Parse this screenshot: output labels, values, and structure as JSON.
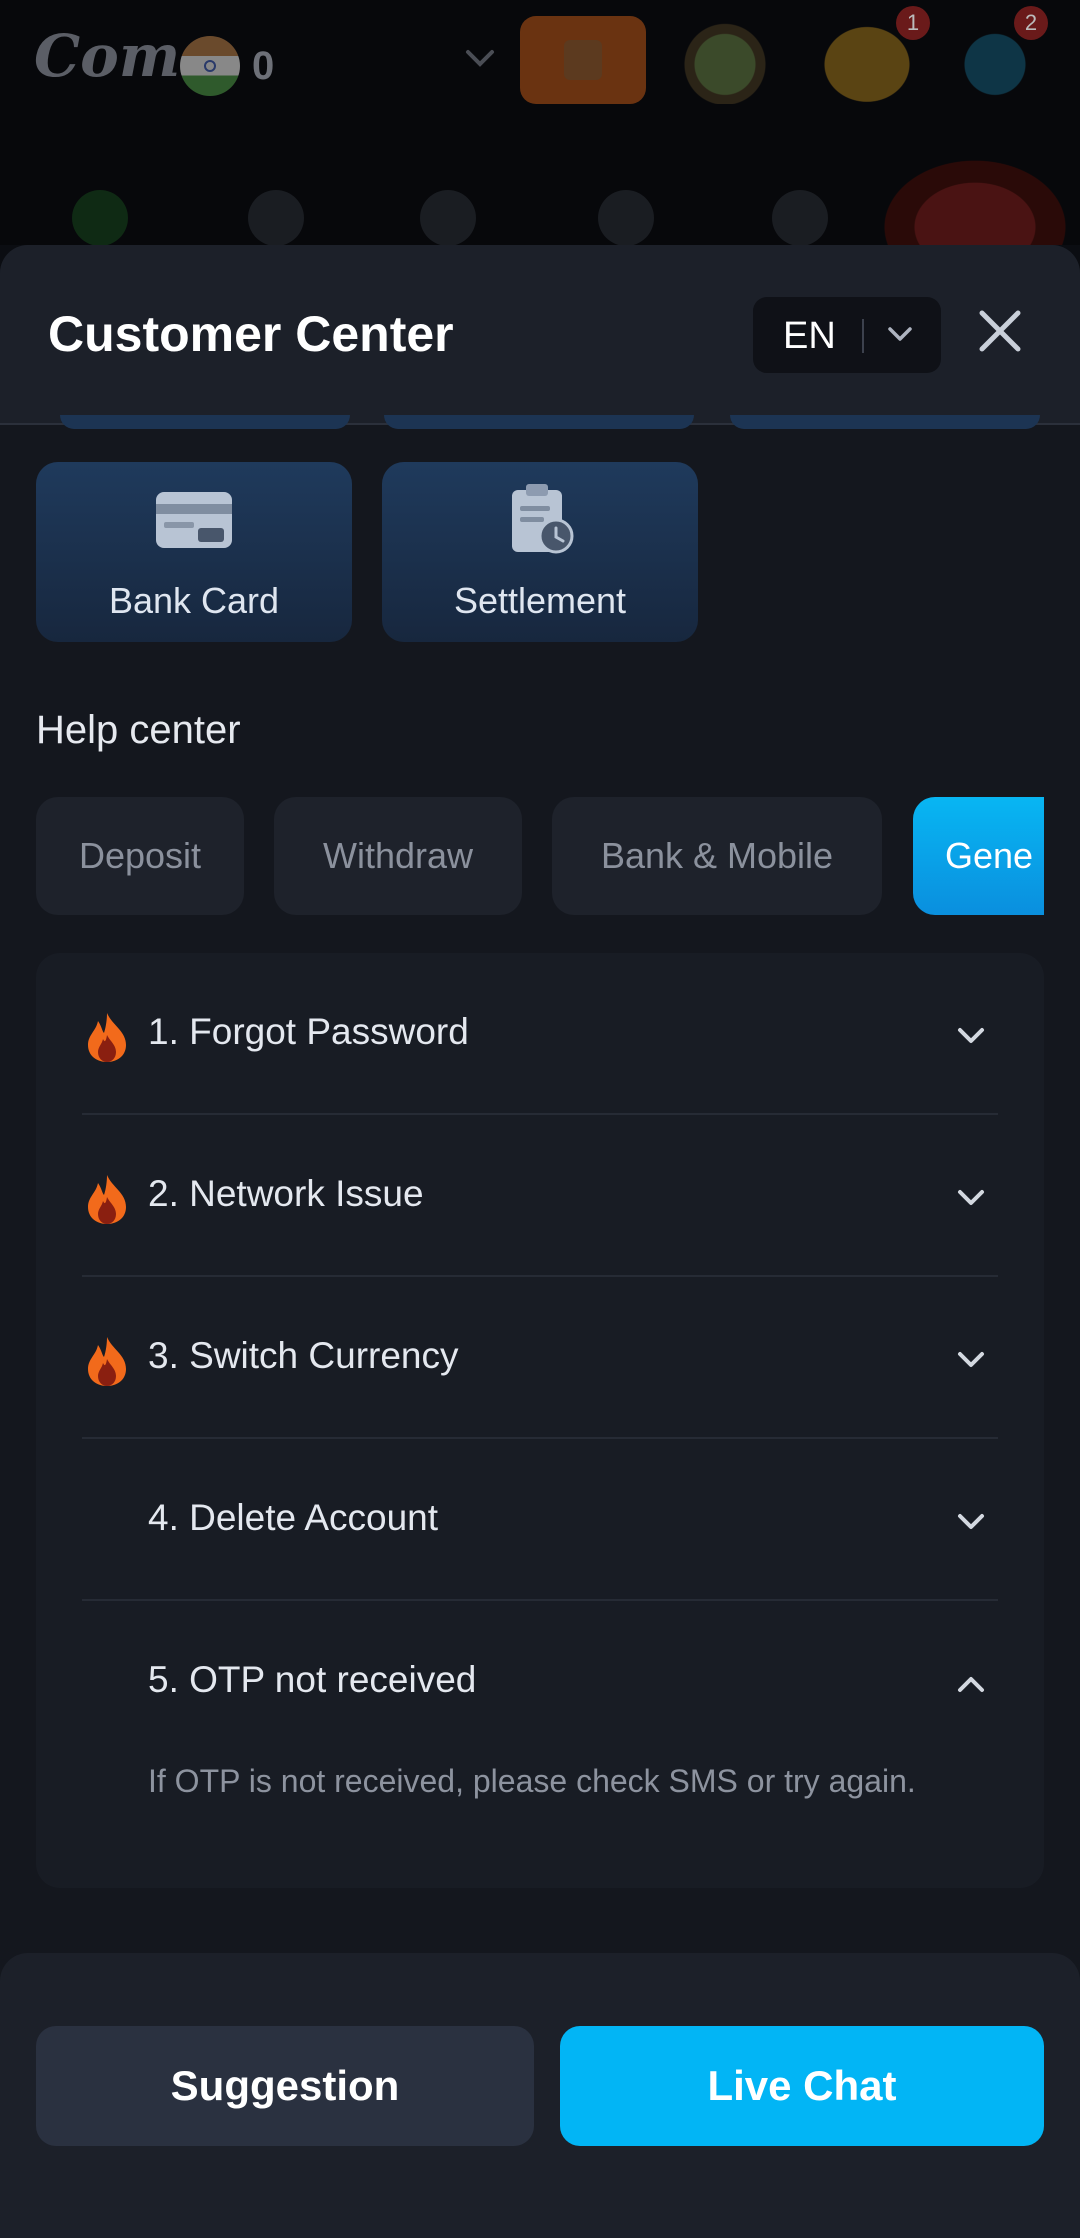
{
  "app_header": {
    "logo_text": "Come",
    "balance": "0",
    "badges": [
      "1",
      "2"
    ]
  },
  "sheet": {
    "title": "Customer Center",
    "language": "EN",
    "cards": [
      {
        "label": "Bank Card",
        "icon": "bank-card-icon"
      },
      {
        "label": "Settlement",
        "icon": "settlement-clipboard-icon"
      }
    ],
    "help_center": {
      "title": "Help center",
      "tabs": [
        "Deposit",
        "Withdraw",
        "Bank & Mobile",
        "Gene"
      ],
      "active_tab": "Gene"
    },
    "faq": [
      {
        "question": "1. Forgot Password",
        "hot": true,
        "expanded": false
      },
      {
        "question": "2. Network Issue",
        "hot": true,
        "expanded": false
      },
      {
        "question": "3. Switch Currency",
        "hot": true,
        "expanded": false
      },
      {
        "question": "4. Delete Account",
        "hot": false,
        "expanded": false
      },
      {
        "question": "5. OTP not received",
        "hot": false,
        "expanded": true,
        "answer": "If OTP is not received, please check SMS or try again."
      }
    ],
    "footer": {
      "suggestion_label": "Suggestion",
      "live_chat_label": "Live Chat"
    }
  },
  "colors": {
    "accent": "#02b5f5",
    "sheet_bg": "#14171e",
    "card_bg": "#1f3a5c",
    "fire": "#f26a1b"
  }
}
